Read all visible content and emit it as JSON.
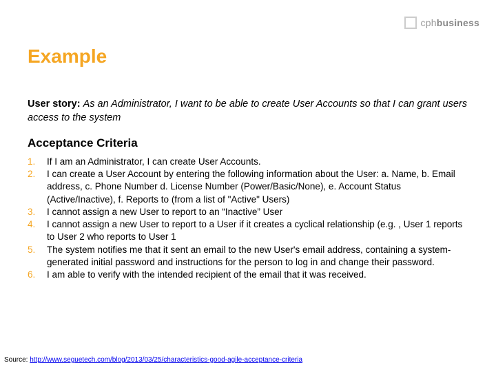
{
  "logo": {
    "prefix": "cph",
    "suffix": "business"
  },
  "title": "Example",
  "userStory": {
    "label": "User story:",
    "text": "As an Administrator, I want to be able to create User Accounts so that I can grant users access to the system"
  },
  "acceptanceTitle": "Acceptance Criteria",
  "criteria": [
    "If I am an Administrator, I can create User Accounts.",
    "I can create a User Account by entering the following information about the User: a. Name, b. Email address, c. Phone Number d. License Number (Power/Basic/None), e. Account Status (Active/Inactive), f. Reports to (from a list of \"Active\" Users)",
    "I cannot assign a new User to report to an “Inactive” User",
    "I cannot assign a new User to report to a User if it creates a cyclical relationship (e.g. , User 1 reports to User 2 who reports to User 1",
    "The system notifies me that it sent an email to the new User's email address, containing a system-generated initial password and instructions for the person to log in and change their password.",
    "I am able to verify with the intended recipient of the email that it was received."
  ],
  "source": {
    "label": "Source: ",
    "url": "http://www.seguetech.com/blog/2013/03/25/characteristics-good-agile-acceptance-criteria"
  }
}
